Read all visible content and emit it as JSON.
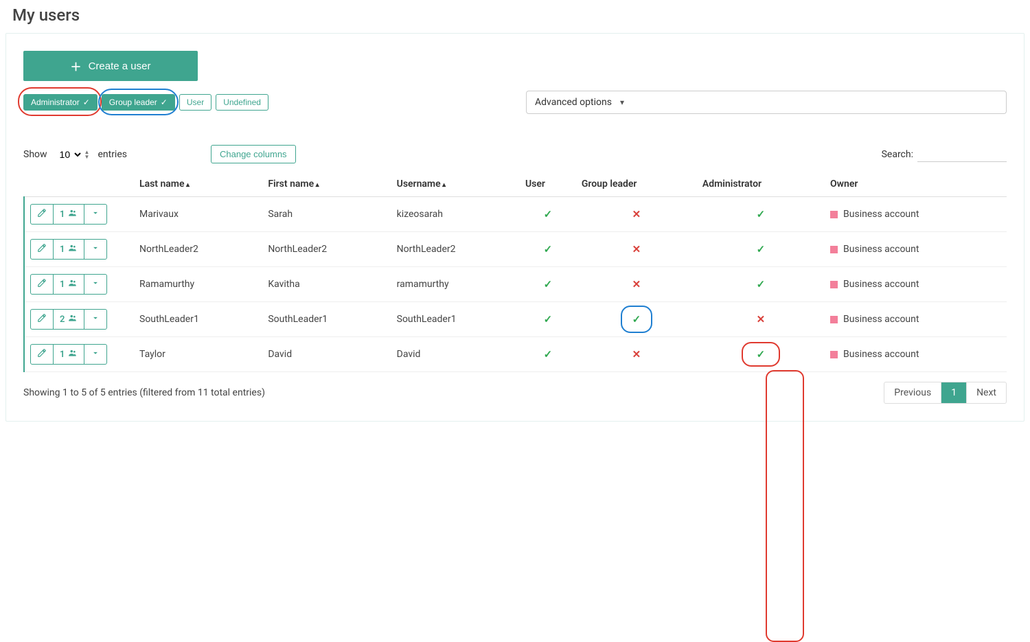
{
  "page_title": "My users",
  "create_button": "Create a user",
  "filter_pills": [
    {
      "label": "Administrator",
      "active": true,
      "highlight": "red"
    },
    {
      "label": "Group leader",
      "active": true,
      "highlight": "blue"
    },
    {
      "label": "User",
      "active": false,
      "highlight": null
    },
    {
      "label": "Undefined",
      "active": false,
      "highlight": null
    }
  ],
  "advanced_options": "Advanced options",
  "table_controls": {
    "show_label": "Show",
    "entries_value": "10",
    "entries_label": "entries",
    "change_columns": "Change columns",
    "search_label": "Search:"
  },
  "columns": {
    "last_name": "Last name",
    "first_name": "First name",
    "username": "Username",
    "user": "User",
    "group_leader": "Group leader",
    "administrator": "Administrator",
    "owner": "Owner"
  },
  "rows": [
    {
      "count": "1",
      "last_name": "Marivaux",
      "first_name": "Sarah",
      "username": "kizeosarah",
      "user": true,
      "group_leader": false,
      "admin": true,
      "owner": "Business account",
      "gl_ring": null,
      "admin_ring": null
    },
    {
      "count": "1",
      "last_name": "NorthLeader2",
      "first_name": "NorthLeader2",
      "username": "NorthLeader2",
      "user": true,
      "group_leader": false,
      "admin": true,
      "owner": "Business account",
      "gl_ring": null,
      "admin_ring": null
    },
    {
      "count": "1",
      "last_name": "Ramamurthy",
      "first_name": "Kavitha",
      "username": "ramamurthy",
      "user": true,
      "group_leader": false,
      "admin": true,
      "owner": "Business account",
      "gl_ring": null,
      "admin_ring": null
    },
    {
      "count": "2",
      "last_name": "SouthLeader1",
      "first_name": "SouthLeader1",
      "username": "SouthLeader1",
      "user": true,
      "group_leader": true,
      "admin": false,
      "owner": "Business account",
      "gl_ring": "blue",
      "admin_ring": null
    },
    {
      "count": "1",
      "last_name": "Taylor",
      "first_name": "David",
      "username": "David",
      "user": true,
      "group_leader": false,
      "admin": true,
      "owner": "Business account",
      "gl_ring": null,
      "admin_ring": "red"
    }
  ],
  "admin_group_ring_rows": 3,
  "footer_info": "Showing 1 to 5 of 5 entries (filtered from 11 total entries)",
  "pager": {
    "previous": "Previous",
    "page": "1",
    "next": "Next"
  },
  "colors": {
    "accent": "#3fa58f",
    "red": "#e03a2f",
    "blue": "#1f7fd1",
    "pink_sq": "#f37f9a"
  }
}
